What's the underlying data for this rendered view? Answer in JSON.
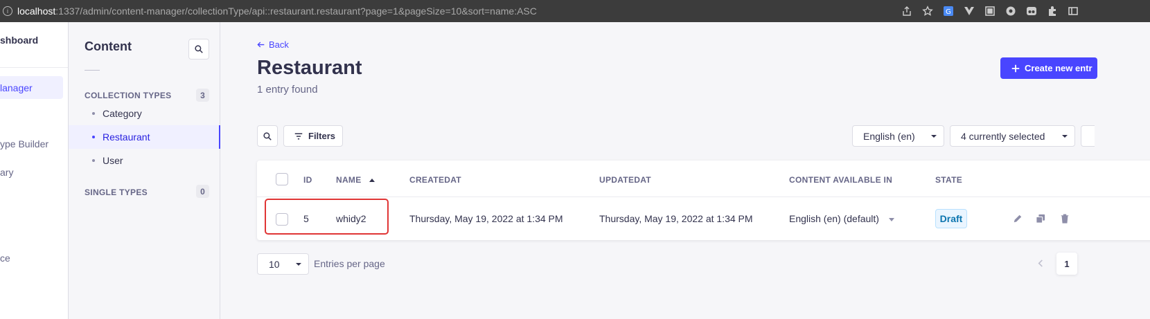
{
  "browser": {
    "url_host": "localhost",
    "url_path": ":1337/admin/content-manager/collectionType/api::restaurant.restaurant?page=1&pageSize=10&sort=name:ASC"
  },
  "mainnav": {
    "dashboard": "shboard",
    "items": [
      "lanager",
      "ype Builder",
      "ary",
      "ce"
    ]
  },
  "panel": {
    "title": "Content",
    "collection_types_label": "COLLECTION TYPES",
    "collection_types_count": "3",
    "items": [
      {
        "label": "Category"
      },
      {
        "label": "Restaurant"
      },
      {
        "label": "User"
      }
    ],
    "single_types_label": "SINGLE TYPES",
    "single_types_count": "0"
  },
  "header": {
    "back_label": "Back",
    "title": "Restaurant",
    "subtitle": "1 entry found",
    "create_label": "Create new entr"
  },
  "toolbar": {
    "filters_label": "Filters",
    "locale": "English (en)",
    "columns": "4 currently selected"
  },
  "table": {
    "columns": [
      "ID",
      "NAME",
      "CREATEDAT",
      "UPDATEDAT",
      "CONTENT AVAILABLE IN",
      "STATE"
    ],
    "rows": [
      {
        "id": "5",
        "name": "whidy2",
        "created": "Thursday, May 19, 2022 at 1:34 PM",
        "updated": "Thursday, May 19, 2022 at 1:34 PM",
        "locale": "English (en) (default)",
        "state": "Draft"
      }
    ]
  },
  "pagination": {
    "page_size": "10",
    "page_size_label": "Entries per page",
    "current_page": "1"
  },
  "colors": {
    "accent": "#4945ff",
    "highlight_border": "#e03535",
    "draft_badge": "#0c75af"
  }
}
